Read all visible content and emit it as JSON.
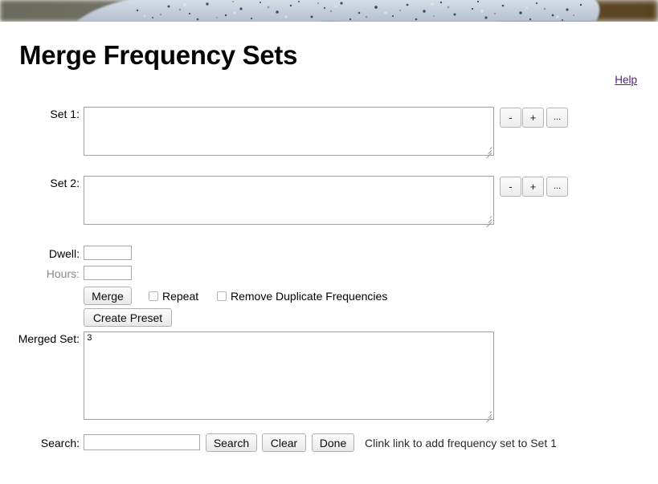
{
  "banner": {
    "alt": "granite-rock-photo-banner",
    "left_bg_color": "#6a6a5e",
    "right_bg_color": "#5a4328",
    "rock_color": "#cfd9e4"
  },
  "header": {
    "title": "Merge Frequency Sets",
    "help_label": "Help"
  },
  "sets": [
    {
      "label": "Set 1:",
      "value": "",
      "buttons": [
        {
          "name": "minus",
          "label": "-"
        },
        {
          "name": "plus",
          "label": "+"
        },
        {
          "name": "more",
          "label": "..."
        }
      ]
    },
    {
      "label": "Set 2:",
      "value": "",
      "buttons": [
        {
          "name": "minus",
          "label": "-"
        },
        {
          "name": "plus",
          "label": "+"
        },
        {
          "name": "more",
          "label": "..."
        }
      ]
    }
  ],
  "dwell": {
    "label": "Dwell:",
    "value": "",
    "placeholder": ""
  },
  "hours": {
    "label": "Hours:",
    "value": "",
    "placeholder": ""
  },
  "actions": {
    "merge_label": "Merge",
    "create_preset_label": "Create Preset",
    "repeat_label": "Repeat",
    "repeat_checked": false,
    "remove_duplicates_label": "Remove Duplicate Frequencies",
    "remove_duplicates_checked": false
  },
  "merged": {
    "label": "Merged Set:",
    "value": "3"
  },
  "search": {
    "label": "Search:",
    "value": "",
    "placeholder": "",
    "search_label": "Search",
    "clear_label": "Clear",
    "done_label": "Done",
    "hint": "Clink link to add frequency set to Set 1"
  }
}
